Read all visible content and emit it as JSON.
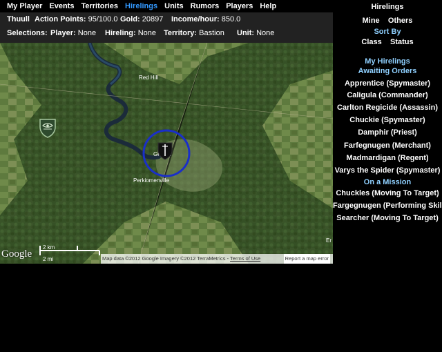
{
  "nav": {
    "items": [
      "My Player",
      "Events",
      "Territories",
      "Hirelings",
      "Units",
      "Rumors",
      "Players",
      "Help"
    ],
    "active": "Hirelings",
    "active_color": "#3399ff"
  },
  "status": {
    "player_name": "Thuull",
    "action_points_label": "Action Points:",
    "action_points_value": "95/100.0",
    "gold_label": "Gold:",
    "gold_value": "20897",
    "income_label": "Income/hour:",
    "income_value": "850.0",
    "selections_label": "Selections:",
    "player_label": "Player:",
    "player_value": "None",
    "hireling_label": "Hireling:",
    "hireling_value": "None",
    "territory_label": "Territory:",
    "territory_value": "Bastion",
    "unit_label": "Unit:",
    "unit_value": "None"
  },
  "map": {
    "labels": {
      "red_hill": "Red Hill",
      "town": "Gr    lane",
      "perkiomenville": "Perkiomenville",
      "edge": "Er"
    },
    "scale_km": "2 km",
    "scale_mi": "2 mi",
    "google_logo": "Google",
    "attribution": "Map data ©2012 Google Imagery ©2012 TerraMetrics",
    "terms": "Terms of Use",
    "report": "Report a map error",
    "selection_ring_color": "#1a2fc8"
  },
  "sidebar": {
    "title": "Hirelings",
    "filter_mine": "Mine",
    "filter_others": "Others",
    "sort_by": "Sort By",
    "sort_class": "Class",
    "sort_status": "Status",
    "my_hirelings": "My Hirelings",
    "awaiting_orders": "Awaiting Orders",
    "awaiting": [
      "Apprentice (Spymaster)",
      "Caligula (Commander)",
      "Carlton Regicide (Assassin)",
      "Chuckie (Spymaster)",
      "Damphir (Priest)",
      "Farfegnugen (Merchant)",
      "Madmardigan (Regent)",
      "Varys the Spider (Spymaster)"
    ],
    "on_a_mission": "On a Mission",
    "mission": [
      "Chuckles (Moving To Target)",
      "Fargegnugen (Performing Skill)",
      "Searcher (Moving To Target)"
    ],
    "header_color": "#8fd0ff"
  }
}
